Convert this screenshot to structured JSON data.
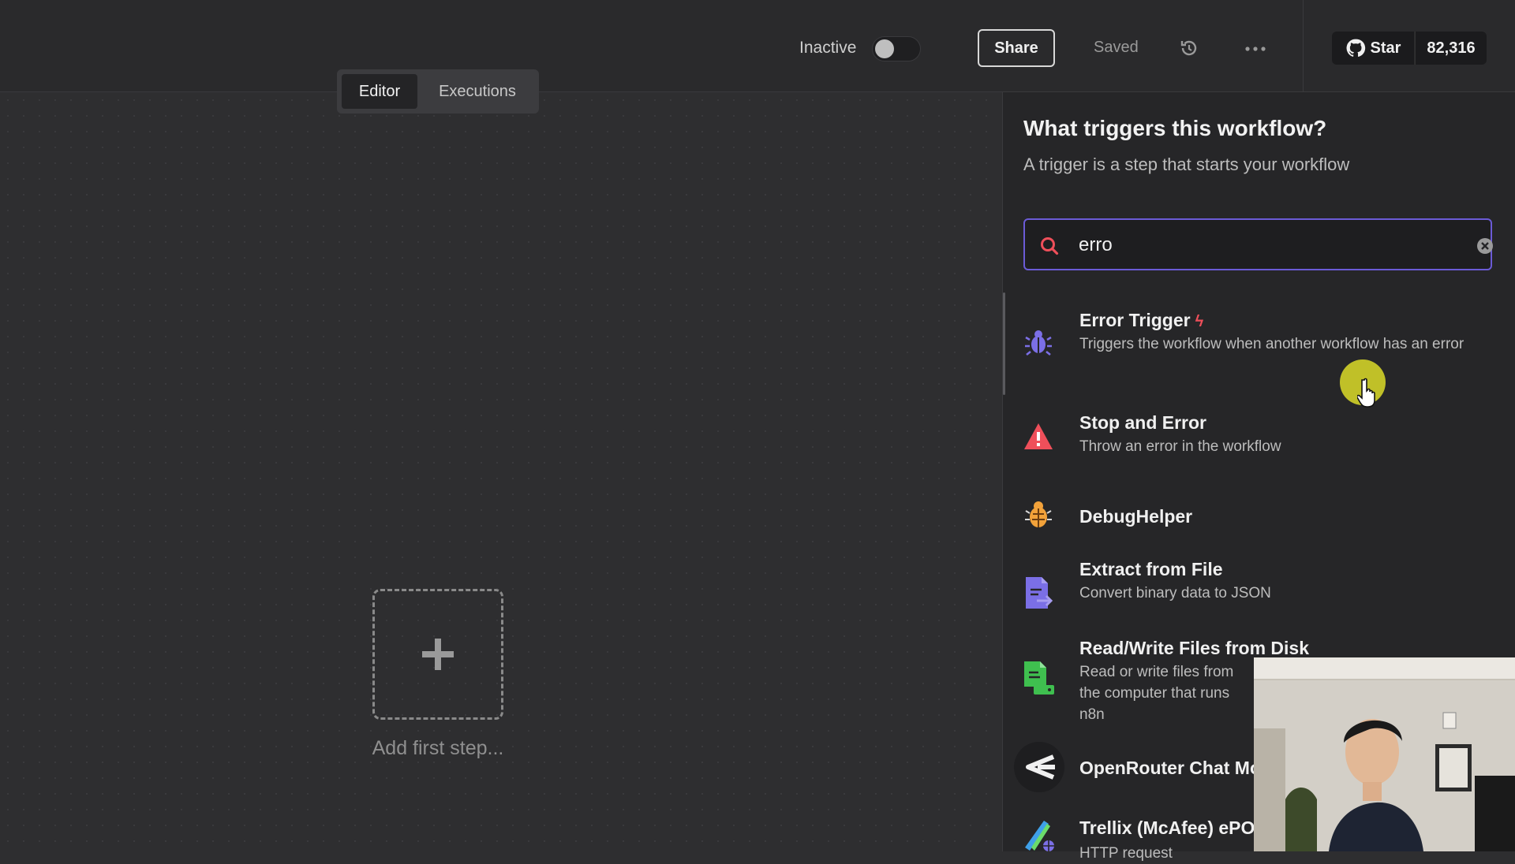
{
  "header": {
    "status_label": "Inactive",
    "share_label": "Share",
    "saved_label": "Saved",
    "star_label": "Star",
    "star_count": "82,316"
  },
  "tabs": [
    {
      "label": "Editor",
      "active": true
    },
    {
      "label": "Executions",
      "active": false
    }
  ],
  "canvas": {
    "add_step_label": "Add first step..."
  },
  "panel": {
    "title": "What triggers this workflow?",
    "subtitle": "A trigger is a step that starts your workflow",
    "search": {
      "value": "erro"
    },
    "items": [
      {
        "name": "Error Trigger",
        "desc": "Triggers the workflow when another workflow has an error",
        "icon": "bug-icon"
      },
      {
        "name": "Stop and Error",
        "desc": "Throw an error in the workflow",
        "icon": "warning-icon"
      },
      {
        "name": "DebugHelper",
        "desc": "",
        "icon": "beetle-icon"
      },
      {
        "name": "Extract from File",
        "desc": "Convert binary data to JSON",
        "icon": "file-extract-icon"
      },
      {
        "name": "Read/Write Files from Disk",
        "desc": "Read or write files from the computer that runs n8n",
        "icon": "file-disk-icon"
      },
      {
        "name": "OpenRouter Chat Model",
        "desc": "",
        "icon": "openrouter-icon"
      },
      {
        "name": "Trellix (McAfee) ePO",
        "desc": "HTTP request",
        "icon": "trellix-icon"
      }
    ]
  },
  "colors": {
    "accent": "#6b5bd6",
    "error": "#ef4f5a"
  }
}
